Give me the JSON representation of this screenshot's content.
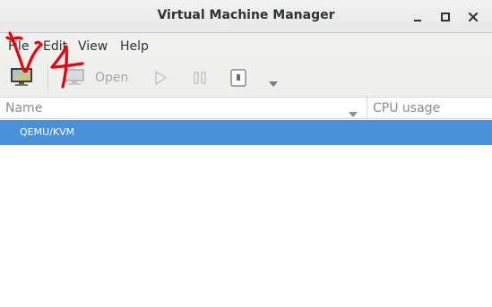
{
  "window": {
    "title": "Virtual Machine Manager",
    "controls": [
      "minimize-icon",
      "maximize-icon",
      "close-icon"
    ]
  },
  "menubar": {
    "items": [
      "File",
      "Edit",
      "View",
      "Help"
    ]
  },
  "toolbar": {
    "new_vm_icon": "monitor-new-icon",
    "open_icon": "monitor-icon",
    "open_label": "Open",
    "run_icon": "play-icon",
    "pause_icon": "pause-icon",
    "shutdown_icon": "power-icon",
    "shutdown_menu_icon": "chevron-down-icon"
  },
  "columns": {
    "name": "Name",
    "cpu": "CPU usage"
  },
  "connections": [
    {
      "label": "QEMU/KVM"
    }
  ],
  "annotation": {
    "text": "V4",
    "color": "#e8000a"
  },
  "colors": {
    "selection": "#4a90d9",
    "disabled_text": "#a6a8a6",
    "header_text": "#8a8e8a"
  }
}
